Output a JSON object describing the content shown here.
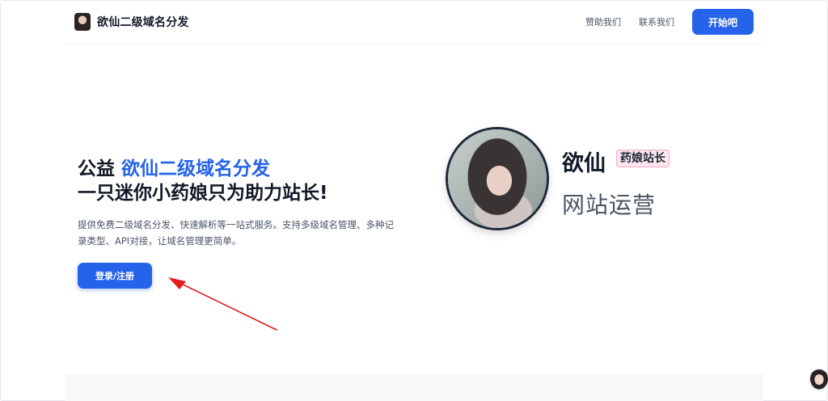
{
  "header": {
    "brand": "欲仙二级域名分发",
    "nav": [
      "赞助我们",
      "联系我们"
    ],
    "start_button": "开始吧"
  },
  "hero": {
    "title_prefix": "公益 ",
    "title_accent": "欲仙二级域名分发",
    "title_line2": "一只迷你小药娘只为助力站长!",
    "description": "提供免费二级域名分发、快速解析等一站式服务。支持多级域名管理、多种记录类型、API对接，让域名管理更简单。",
    "login_button": "登录/注册"
  },
  "profile": {
    "name": "欲仙",
    "badge": "药娘站长",
    "role": "网站运营"
  },
  "colors": {
    "accent": "#2563eb",
    "annotation_arrow": "#e11d1d",
    "badge_bg": "#fce7ef"
  }
}
